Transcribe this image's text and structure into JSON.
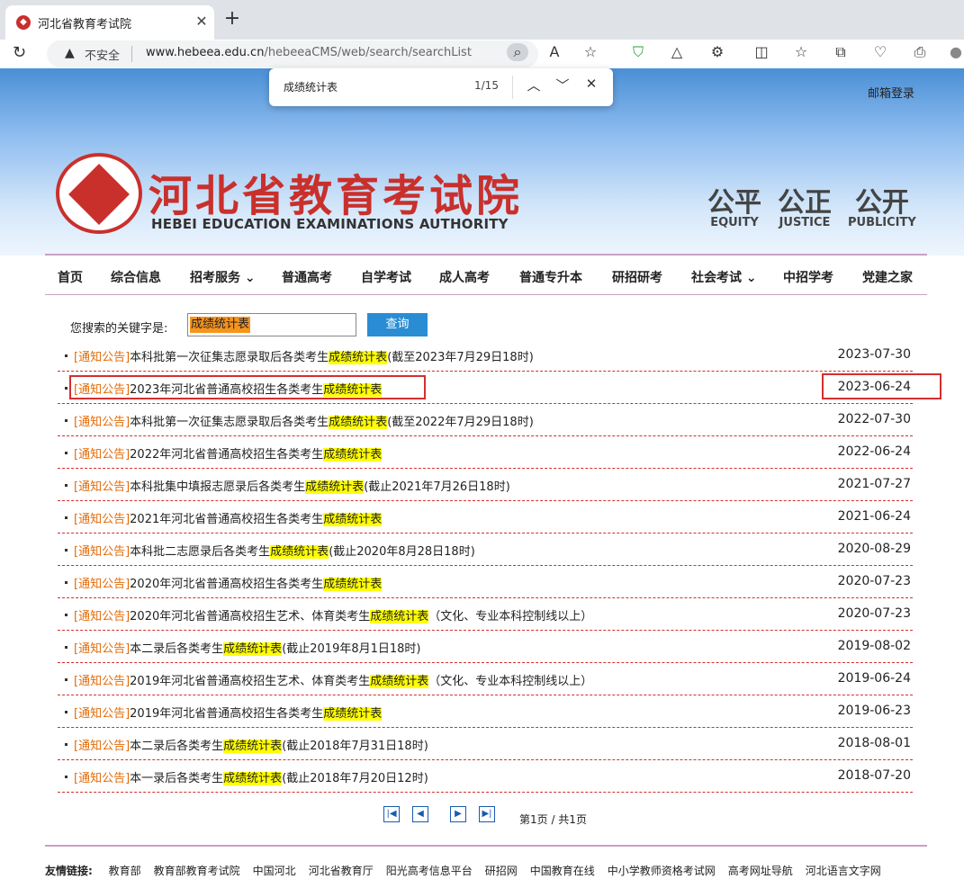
{
  "browser": {
    "tab_title": "河北省教育考试院",
    "insecure_label": "不安全",
    "url_host": "www.hebeea.edu.cn",
    "url_path": "/hebeeaCMS/web/search/searchList"
  },
  "find": {
    "query": "成绩统计表",
    "count": "1/15"
  },
  "header": {
    "mail_login": "邮箱登录",
    "logo_cn": "河北省教育考试院",
    "logo_en": "HEBEI EDUCATION EXAMINATIONS AUTHORITY",
    "mottos": [
      {
        "cn": "公平",
        "en": "EQUITY"
      },
      {
        "cn": "公正",
        "en": "JUSTICE"
      },
      {
        "cn": "公开",
        "en": "PUBLICITY"
      }
    ]
  },
  "nav": [
    "首页",
    "综合信息",
    "招考服务 ⌄",
    "普通高考",
    "自学考试",
    "成人高考",
    "普通专升本",
    "研招研考",
    "社会考试 ⌄",
    "中招学考",
    "党建之家"
  ],
  "search": {
    "label": "您搜索的关键字是:",
    "keyword": "成绩统计表",
    "button": "查询"
  },
  "results": [
    {
      "tag": "[通知公告]",
      "pre": "本科批第一次征集志愿录取后各类考生",
      "hl": "成绩统计表",
      "post": "(截至2023年7月29日18时)",
      "date": "2023-07-30"
    },
    {
      "tag": "[通知公告]",
      "pre": "2023年河北省普通高校招生各类考生",
      "hl": "成绩统计表",
      "post": "",
      "date": "2023-06-24"
    },
    {
      "tag": "[通知公告]",
      "pre": "本科批第一次征集志愿录取后各类考生",
      "hl": "成绩统计表",
      "post": "(截至2022年7月29日18时)",
      "date": "2022-07-30"
    },
    {
      "tag": "[通知公告]",
      "pre": "2022年河北省普通高校招生各类考生",
      "hl": "成绩统计表",
      "post": "",
      "date": "2022-06-24"
    },
    {
      "tag": "[通知公告]",
      "pre": "本科批集中填报志愿录后各类考生",
      "hl": "成绩统计表",
      "post": "(截止2021年7月26日18时)",
      "date": "2021-07-27"
    },
    {
      "tag": "[通知公告]",
      "pre": "2021年河北省普通高校招生各类考生",
      "hl": "成绩统计表",
      "post": "",
      "date": "2021-06-24"
    },
    {
      "tag": "[通知公告]",
      "pre": "本科批二志愿录后各类考生",
      "hl": "成绩统计表",
      "post": "(截止2020年8月28日18时)",
      "date": "2020-08-29"
    },
    {
      "tag": "[通知公告]",
      "pre": "2020年河北省普通高校招生各类考生",
      "hl": "成绩统计表",
      "post": "",
      "date": "2020-07-23"
    },
    {
      "tag": "[通知公告]",
      "pre": "2020年河北省普通高校招生艺术、体育类考生",
      "hl": "成绩统计表",
      "post": "（文化、专业本科控制线以上）",
      "date": "2020-07-23"
    },
    {
      "tag": "[通知公告]",
      "pre": "本二录后各类考生",
      "hl": "成绩统计表",
      "post": "(截止2019年8月1日18时)",
      "date": "2019-08-02"
    },
    {
      "tag": "[通知公告]",
      "pre": "2019年河北省普通高校招生艺术、体育类考生",
      "hl": "成绩统计表",
      "post": "（文化、专业本科控制线以上）",
      "date": "2019-06-24"
    },
    {
      "tag": "[通知公告]",
      "pre": "2019年河北省普通高校招生各类考生",
      "hl": "成绩统计表",
      "post": "",
      "date": "2019-06-23"
    },
    {
      "tag": "[通知公告]",
      "pre": "本二录后各类考生",
      "hl": "成绩统计表",
      "post": "(截止2018年7月31日18时)",
      "date": "2018-08-01"
    },
    {
      "tag": "[通知公告]",
      "pre": "本一录后各类考生",
      "hl": "成绩统计表",
      "post": "(截止2018年7月20日12时)",
      "date": "2018-07-20"
    }
  ],
  "pager": {
    "info": "第1页 / 共1页"
  },
  "footer": {
    "label": "友情链接:",
    "links": [
      "教育部",
      "教育部教育考试院",
      "中国河北",
      "河北省教育厅",
      "阳光高考信息平台",
      "研招网",
      "中国教育在线",
      "中小学教师资格考试网",
      "高考网址导航",
      "河北语言文字网"
    ]
  },
  "colors": {
    "brand_red": "#c9302c",
    "tag_orange": "#e36c09",
    "highlight_yellow": "#ffff00",
    "active_match_orange": "#f7941d",
    "button_blue": "#2a8dd4"
  }
}
